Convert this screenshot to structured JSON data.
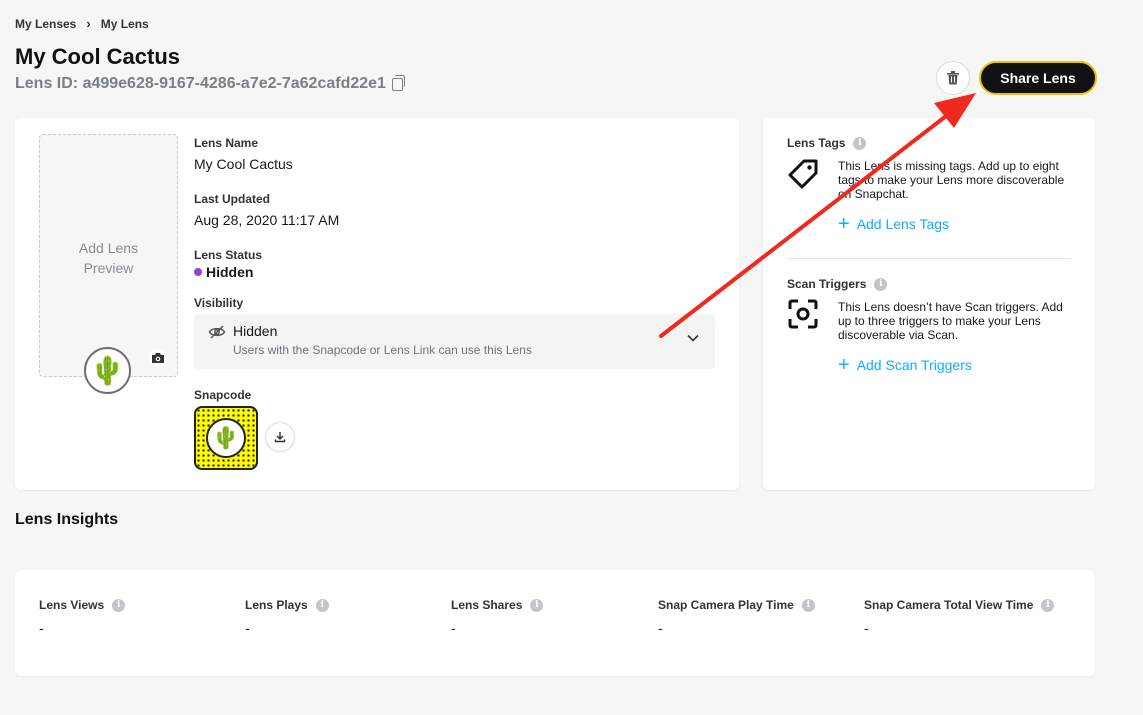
{
  "breadcrumb": {
    "parent": "My Lenses",
    "separator": "›",
    "current": "My Lens"
  },
  "header": {
    "title": "My Cool Cactus",
    "lens_id": "Lens ID: a499e628-9167-4286-a7e2-7a62cafd22e1",
    "share_label": "Share Lens"
  },
  "preview": {
    "line1": "Add Lens",
    "line2": "Preview",
    "avatar_glyph": "🌵"
  },
  "details": {
    "name_label": "Lens Name",
    "name_value": "My Cool Cactus",
    "updated_label": "Last Updated",
    "updated_value": "Aug 28, 2020 11:17 AM",
    "status_label": "Lens Status",
    "status_value": "Hidden",
    "visibility_label": "Visibility",
    "visibility_value": "Hidden",
    "visibility_desc": "Users with the Snapcode or Lens Link can use this Lens",
    "snapcode_label": "Snapcode"
  },
  "side": {
    "tags_title": "Lens Tags",
    "tags_desc": "This Lens is missing tags. Add up to eight tags to make your Lens more discoverable on Snapchat.",
    "tags_link": "Add Lens Tags",
    "triggers_title": "Scan Triggers",
    "triggers_desc": "This Lens doesn’t have Scan triggers. Add up to three triggers to make your Lens discoverable via Scan.",
    "triggers_link": "Add Scan Triggers",
    "link_plus": "+"
  },
  "insights": {
    "heading": "Lens Insights",
    "info_glyph": "i",
    "metrics": [
      {
        "label": "Lens Views",
        "value": "-"
      },
      {
        "label": "Lens Plays",
        "value": "-"
      },
      {
        "label": "Lens Shares",
        "value": "-"
      },
      {
        "label": "Snap Camera Play Time",
        "value": "-"
      },
      {
        "label": "Snap Camera Total View Time",
        "value": "-"
      }
    ]
  },
  "colors": {
    "accent_link": "#0fadff",
    "share_border": "#f2c200",
    "status_dot": "#9b3fcf",
    "annotation_arrow": "#ee2a1f",
    "snapcode_bg": "#fffc00"
  },
  "icons": [
    "chevron-right-icon",
    "copy-icon",
    "trash-icon",
    "camera-icon",
    "eye-off-icon",
    "chevron-down-icon",
    "download-icon",
    "tag-icon",
    "scan-icon",
    "info-icon",
    "cactus-emoji"
  ]
}
